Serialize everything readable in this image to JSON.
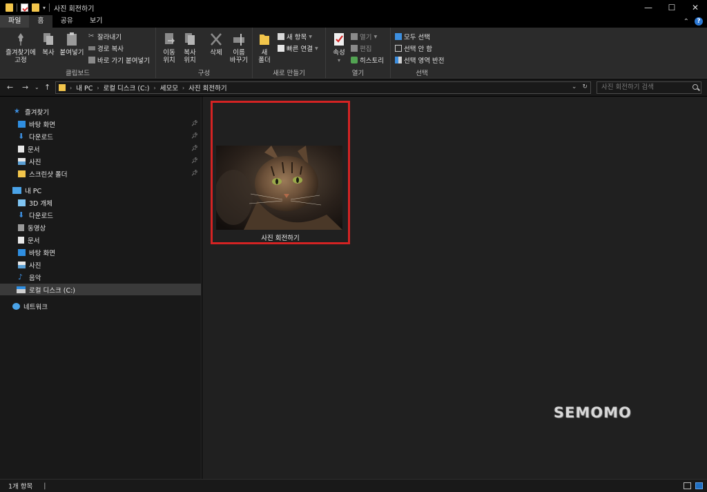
{
  "window": {
    "title": "사진 회전하기",
    "controls": [
      "—",
      "☐",
      "✕"
    ]
  },
  "ribbon_tabs": [
    "파일",
    "홈",
    "공유",
    "보기"
  ],
  "ribbon": {
    "clipboard": {
      "label": "클립보드",
      "pin": "즐겨찾기에\n고정",
      "copy": "복사",
      "paste": "붙여넣기",
      "cut": "잘라내기",
      "copy_path": "경로 복사",
      "paste_shortcut": "바로 가기 붙여넣기"
    },
    "organize": {
      "label": "구성",
      "move_to": "이동\n위치",
      "copy_to": "복사\n위치",
      "delete": "삭제",
      "rename": "이름\n바꾸기"
    },
    "new": {
      "label": "새로 만들기",
      "new_folder": "새\n폴더",
      "new_item": "새 항목",
      "easy_access": "빠른 연결"
    },
    "open": {
      "label": "열기",
      "properties": "속성",
      "open": "열기",
      "edit": "편집",
      "history": "히스토리"
    },
    "select": {
      "label": "선택",
      "select_all": "모두 선택",
      "select_none": "선택 안 함",
      "invert": "선택 영역 반전"
    }
  },
  "address": {
    "crumbs": [
      "내 PC",
      "로컬 디스크 (C:)",
      "세모모",
      "사진 회전하기"
    ],
    "search_placeholder": "사진 회전하기 검색"
  },
  "sidebar": {
    "quick_access": "즐겨찾기",
    "quick_items": [
      "바탕 화면",
      "다운로드",
      "문서",
      "사진",
      "스크린샷 폴더"
    ],
    "this_pc": "내 PC",
    "pc_items": [
      "3D 개체",
      "다운로드",
      "동영상",
      "문서",
      "바탕 화면",
      "사진",
      "음악",
      "로컬 디스크 (C:)"
    ],
    "network": "네트워크"
  },
  "content": {
    "items": [
      {
        "name": "사진 회전하기"
      }
    ],
    "watermark": "SEMOMO"
  },
  "status": {
    "count": "1개 항목",
    "sep": "|"
  },
  "colors": {
    "highlight_border": "#d42323",
    "folder": "#f2c54b",
    "accent_blue": "#2b77d3"
  }
}
